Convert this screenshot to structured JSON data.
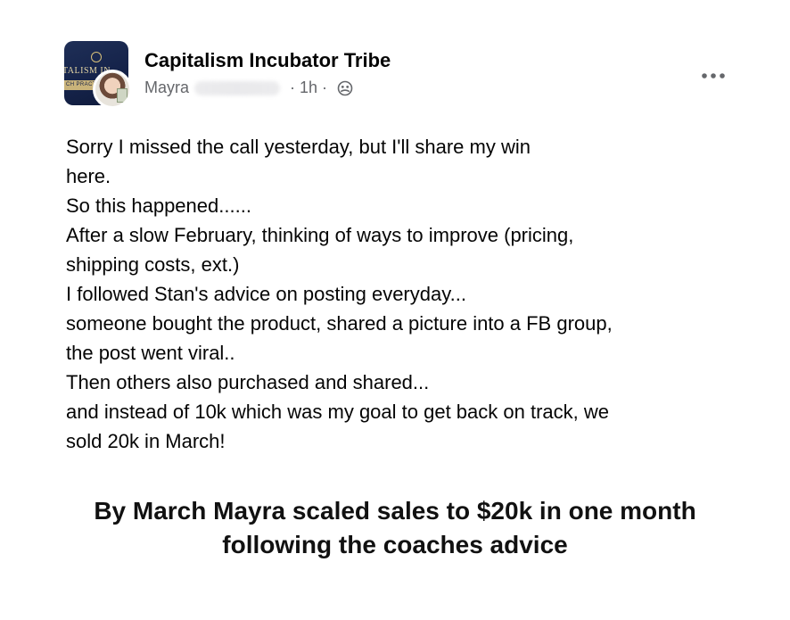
{
  "header": {
    "group_name": "Capitalism Incubator Tribe",
    "author_first_name": "Mayra",
    "separator": "·",
    "time": "1h",
    "privacy_icon": "group-members-icon",
    "more_icon": "more-options-icon",
    "group_avatar_text_1": "TALISM IN",
    "group_avatar_text_2": "CH PRACT"
  },
  "post": {
    "lines": [
      "Sorry I missed the call yesterday, but I'll share my win",
      "here.",
      "So this happened......",
      "After a slow February, thinking of ways to improve (pricing,",
      "shipping costs, ext.)",
      "I followed Stan's advice on posting everyday...",
      "someone bought the product, shared a picture into a FB group,",
      "the post went viral..",
      "Then others also purchased and shared...",
      "and instead of 10k which was my goal to get back on track, we",
      "sold 20k in March!"
    ]
  },
  "caption": {
    "line1": "By March Mayra scaled sales to $20k in one month",
    "line2": "following the coaches advice"
  },
  "colors": {
    "text_primary": "#050505",
    "text_secondary": "#65676b",
    "group_avatar_bg": "#1f2f57",
    "group_avatar_accent": "#c9b37a"
  }
}
